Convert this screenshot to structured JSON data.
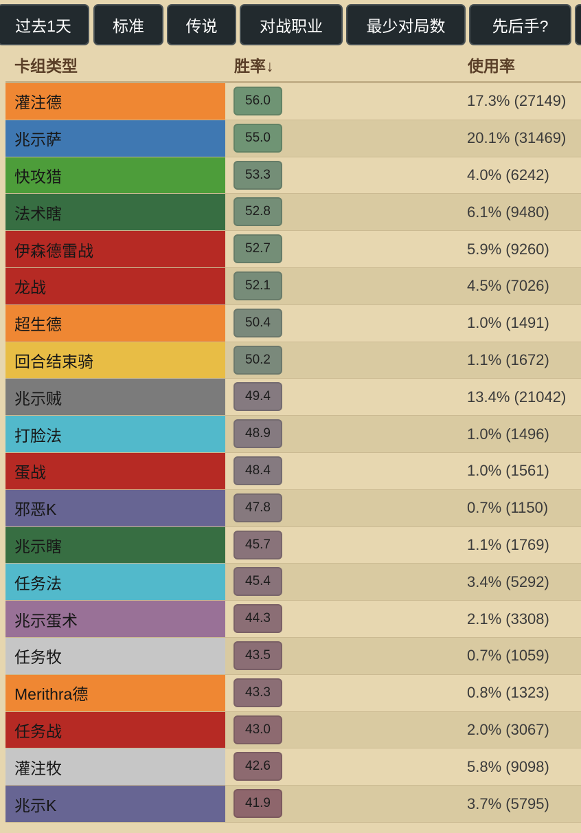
{
  "filters": [
    {
      "label": "过去1天"
    },
    {
      "label": "标准"
    },
    {
      "label": "传说"
    },
    {
      "label": "对战职业"
    },
    {
      "label": "最少对局数"
    },
    {
      "label": "先后手?"
    }
  ],
  "table": {
    "headers": {
      "deck_type": "卡组类型",
      "winrate": "胜率↓",
      "usage": "使用率"
    },
    "rows": [
      {
        "deck": "灌注德",
        "deck_color": "#ef8733",
        "winrate": "56.0",
        "winrate_color": "#6f9474",
        "usage": "17.3% (27149)"
      },
      {
        "deck": "兆示萨",
        "deck_color": "#3f78b2",
        "winrate": "55.0",
        "winrate_color": "#6f9474",
        "usage": "20.1% (31469)"
      },
      {
        "deck": "快攻猎",
        "deck_color": "#4d9d3a",
        "winrate": "53.3",
        "winrate_color": "#748e77",
        "usage": "4.0% (6242)"
      },
      {
        "deck": "法术瞎",
        "deck_color": "#376e42",
        "winrate": "52.8",
        "winrate_color": "#748e77",
        "usage": "6.1% (9480)"
      },
      {
        "deck": "伊森德雷战",
        "deck_color": "#b62a24",
        "winrate": "52.7",
        "winrate_color": "#748e77",
        "usage": "5.9% (9260)"
      },
      {
        "deck": "龙战",
        "deck_color": "#b62a24",
        "winrate": "52.1",
        "winrate_color": "#778c79",
        "usage": "4.5% (7026)"
      },
      {
        "deck": "超生德",
        "deck_color": "#ef8733",
        "winrate": "50.4",
        "winrate_color": "#7a897b",
        "usage": "1.0% (1491)"
      },
      {
        "deck": "回合结束骑",
        "deck_color": "#e8bd45",
        "winrate": "50.2",
        "winrate_color": "#7a897b",
        "usage": "1.1% (1672)"
      },
      {
        "deck": "兆示贼",
        "deck_color": "#7b7b7b",
        "winrate": "49.4",
        "winrate_color": "#857a80",
        "usage": "13.4% (21042)"
      },
      {
        "deck": "打脸法",
        "deck_color": "#52b9cb",
        "winrate": "48.9",
        "winrate_color": "#857a80",
        "usage": "1.0% (1496)"
      },
      {
        "deck": "蛋战",
        "deck_color": "#b62a24",
        "winrate": "48.4",
        "winrate_color": "#857a80",
        "usage": "1.0% (1561)"
      },
      {
        "deck": "邪恶K",
        "deck_color": "#676593",
        "winrate": "47.8",
        "winrate_color": "#86797e",
        "usage": "0.7% (1150)"
      },
      {
        "deck": "兆示瞎",
        "deck_color": "#376e42",
        "winrate": "45.7",
        "winrate_color": "#89737a",
        "usage": "1.1% (1769)"
      },
      {
        "deck": "任务法",
        "deck_color": "#52b9cb",
        "winrate": "45.4",
        "winrate_color": "#89737a",
        "usage": "3.4% (5292)"
      },
      {
        "deck": "兆示蛋术",
        "deck_color": "#997197",
        "winrate": "44.3",
        "winrate_color": "#8b6e75",
        "usage": "2.1% (3308)"
      },
      {
        "deck": "任务牧",
        "deck_color": "#c6c6c6",
        "winrate": "43.5",
        "winrate_color": "#8b6e75",
        "usage": "0.7% (1059)"
      },
      {
        "deck": "Merithra德",
        "deck_color": "#ef8733",
        "winrate": "43.3",
        "winrate_color": "#8b6e75",
        "usage": "0.8% (1323)"
      },
      {
        "deck": "任务战",
        "deck_color": "#b62a24",
        "winrate": "43.0",
        "winrate_color": "#8d6a70",
        "usage": "2.0% (3067)"
      },
      {
        "deck": "灌注牧",
        "deck_color": "#c6c6c6",
        "winrate": "42.6",
        "winrate_color": "#8d6a70",
        "usage": "5.8% (9098)"
      },
      {
        "deck": "兆示K",
        "deck_color": "#676593",
        "winrate": "41.9",
        "winrate_color": "#8e666c",
        "usage": "3.7% (5795)"
      }
    ]
  }
}
